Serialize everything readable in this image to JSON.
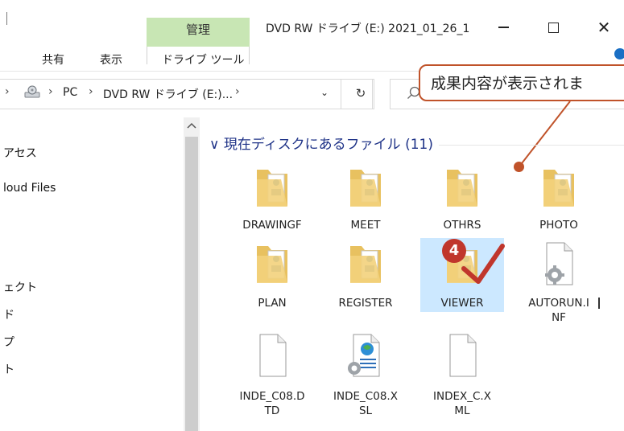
{
  "titlebar": {
    "context_tab": "管理",
    "window_title": "DVD RW ドライブ (E:) 2021_01_26_1",
    "close_glyph": "✕"
  },
  "ribbon": {
    "tabs": [
      "共有",
      "表示",
      "ドライブ ツール"
    ]
  },
  "address": {
    "crumbs": [
      "PC",
      "DVD RW ドライブ (E:)...",
      ""
    ],
    "separator": "›",
    "refresh_glyph": "↻",
    "dropdown_glyph": "⌄"
  },
  "callout": {
    "text": "成果内容が表示されま"
  },
  "navpane": {
    "items": [
      "アセス",
      "loud Files",
      "ェクト",
      "ド",
      "プ",
      "ト"
    ]
  },
  "content": {
    "group_header": "現在ディスクにあるファイル (11)",
    "group_chevron": "∨",
    "items": [
      {
        "name": "DRAWINGF",
        "type": "folder"
      },
      {
        "name": "MEET",
        "type": "folder"
      },
      {
        "name": "OTHRS",
        "type": "folder"
      },
      {
        "name": "PHOTO",
        "type": "folder"
      },
      {
        "name": "PLAN",
        "type": "folder"
      },
      {
        "name": "REGISTER",
        "type": "folder"
      },
      {
        "name": "VIEWER",
        "type": "folder",
        "selected": true
      },
      {
        "name": "AUTORUN.INF",
        "type": "config-file"
      },
      {
        "name": "INDE_C08.DTD",
        "type": "file"
      },
      {
        "name": "INDE_C08.XSL",
        "type": "xsl-file"
      },
      {
        "name": "INDEX_C.XML",
        "type": "file"
      }
    ]
  },
  "annotation": {
    "step_number": "4"
  },
  "colors": {
    "accent": "#c0532a",
    "selection": "#cce8ff",
    "context_tab": "#c8e6b4",
    "header_text": "#1e3287"
  }
}
